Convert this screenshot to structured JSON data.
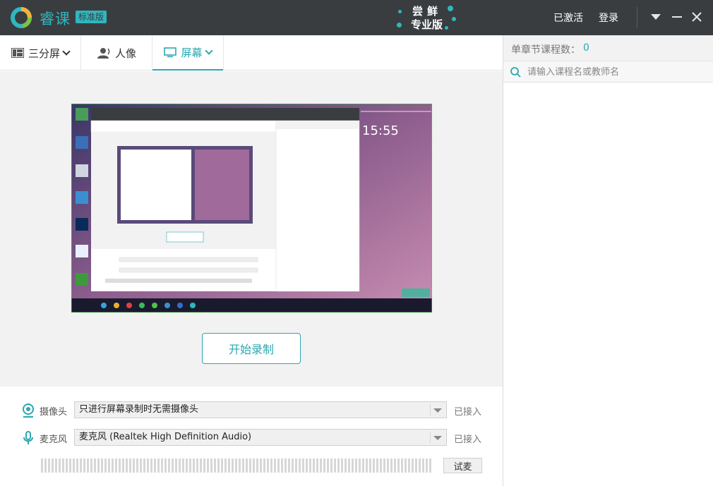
{
  "titlebar": {
    "app_name": "睿课",
    "edition": "标准版",
    "promo_top": "尝鲜",
    "promo_bottom": "专业版",
    "activated": "已激活",
    "login": "登录"
  },
  "tabs": [
    {
      "label": "三分屏",
      "icon": "three-split-icon"
    },
    {
      "label": "人像",
      "icon": "person-icon"
    },
    {
      "label": "屏幕",
      "icon": "monitor-icon",
      "active": true
    }
  ],
  "preview": {
    "start_label": "开始录制"
  },
  "devices": {
    "camera": {
      "label": "摄像头",
      "value": "只进行屏幕录制时无需摄像头",
      "status": "已接入",
      "icon": "camera-icon"
    },
    "mic": {
      "label": "麦克风",
      "value": "麦克风 (Realtek High Definition Audio)",
      "status": "已接入",
      "icon": "microphone-icon"
    },
    "test_label": "试麦"
  },
  "right_panel": {
    "title": "单章节课程数：",
    "count": "0",
    "search_placeholder": "请输入课程名或教师名"
  },
  "colors": {
    "accent": "#2aa8b1",
    "titlebar_bg": "#3a3d40"
  }
}
